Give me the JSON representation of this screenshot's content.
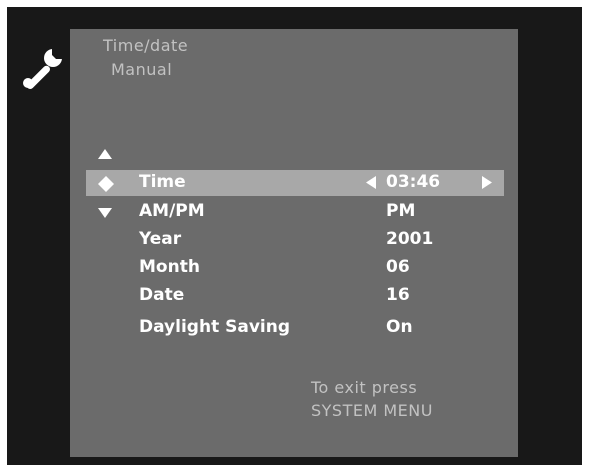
{
  "header": {
    "title": "Time/date",
    "subtitle": "Manual"
  },
  "menu": {
    "items": [
      {
        "label": "Time",
        "value": "03:46"
      },
      {
        "label": "AM/PM",
        "value": "PM"
      },
      {
        "label": "Year",
        "value": "2001"
      },
      {
        "label": "Month",
        "value": "06"
      },
      {
        "label": "Date",
        "value": "16"
      },
      {
        "label": "Daylight Saving",
        "value": "On"
      }
    ]
  },
  "footer": {
    "line1": "To exit press",
    "line2": "SYSTEM MENU"
  },
  "icons": {
    "settings": "wrench-icon",
    "scroll_up": "triangle-up-icon",
    "scroll_down": "triangle-down-icon",
    "selector": "diamond-icon",
    "decrement": "triangle-left-icon",
    "increment": "triangle-right-icon"
  },
  "colors": {
    "background": "#181818",
    "panel": "#6b6b6b",
    "selection": "#a8a8a8",
    "text": "#ffffff",
    "muted_text": "#c2c2c2"
  }
}
